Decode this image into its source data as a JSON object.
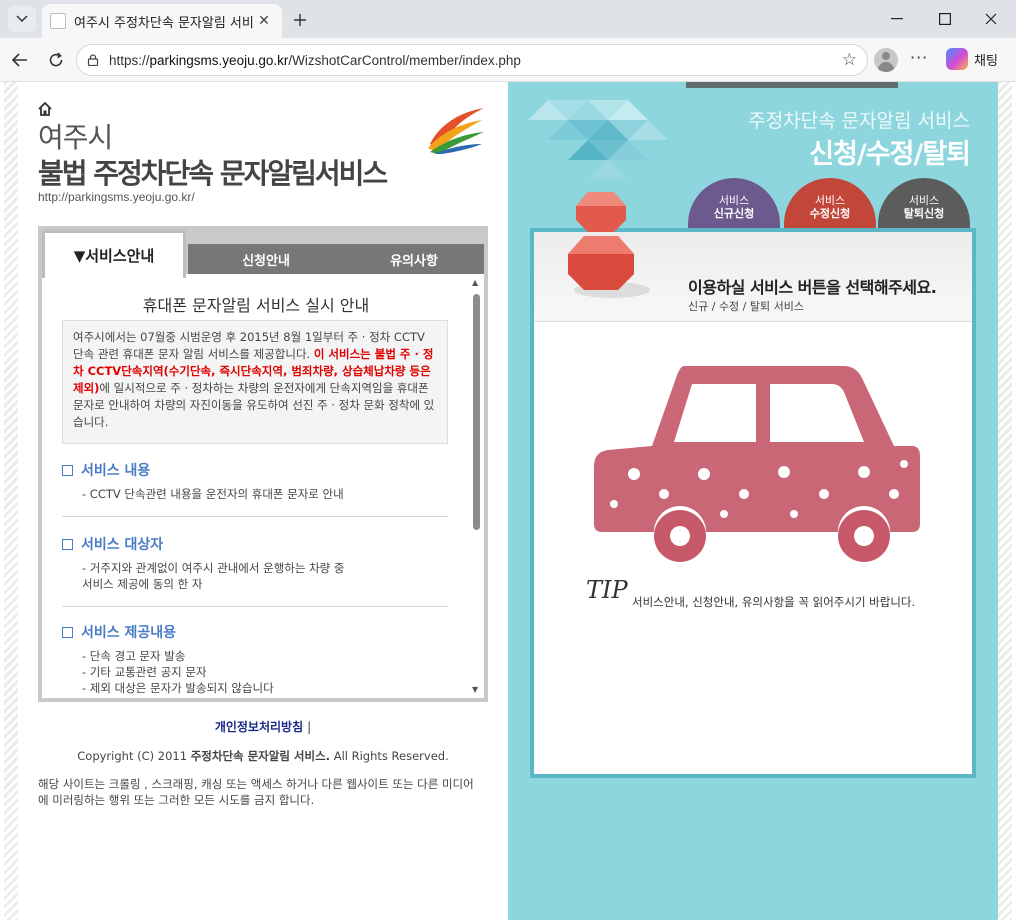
{
  "browser": {
    "tab_title": "여주시 주정차단속 문자알림 서비스",
    "url_prefix": "https://",
    "url_host": "parkingsms.yeoju.go.kr",
    "url_path": "/WizshotCarControl/member/index.php",
    "copilot_label": "채팅"
  },
  "header": {
    "city": "여주시",
    "service": "불법 주정차단속 문자알림서비스",
    "site_url": "http://parkingsms.yeoju.go.kr/"
  },
  "info_tabs": {
    "service_info": "▼서비스안내",
    "apply_info": "신청안내",
    "notice": "유의사항"
  },
  "content": {
    "title": "휴대폰 문자알림 서비스 실시 안내",
    "notice_line1": "여주시에서는 07월중 시범운영 후 2015년 8월 1일부터 주 · 정차 CCTV 단속 관련 휴대폰 문자 알림 서비스를 제공합니다.",
    "notice_red": "이 서비스는 불법 주 · 정차 CCTV단속지역(수기단속, 즉시단속지역, 범죄차량, 상습체납차량 등은 제외)",
    "notice_line2": "에 일시적으로 주 · 정차하는 차량의 운전자에게 단속지역임을 휴대폰 문자로 안내하여 차량의 자진이동을 유도하여 선진 주 · 정차 문화 정착에 있습니다.",
    "sections": [
      {
        "heading": "서비스 내용",
        "lines": [
          "- CCTV 단속관련 내용을 운전자의 휴대폰 문자로 안내"
        ]
      },
      {
        "heading": "서비스 대상자",
        "lines": [
          "- 거주지와 관계없이 여주시 관내에서 운행하는 차량 중",
          "서비스 제공에 동의 한 자"
        ]
      },
      {
        "heading": "서비스 제공내용",
        "lines": [
          "- 단속 경고 문자 발송",
          "- 기타 교통관련 공지 문자",
          "- 제외 대상은 문자가 발송되지 않습니다"
        ]
      }
    ]
  },
  "footer": {
    "privacy": "개인정보처리방침",
    "separator": "|",
    "copyright_prefix": "Copyright (C) 2011 ",
    "copyright_bold": "주정차단속 문자알림 서비스.",
    "copyright_suffix": " All Rights Reserved.",
    "legal": "해당 사이트는 크롤링 , 스크래핑, 캐싱 또는 액세스 하거나 다른 웹사이트 또는 다른 미디어에 미러링하는 행위 또는 그러한 모든 시도를 금지 합니다."
  },
  "apply": {
    "subtitle": "주정차단속 문자알림 서비스",
    "title": "신청/수정/탈퇴",
    "buttons": [
      {
        "top": "서비스",
        "bottom": "신규신청"
      },
      {
        "top": "서비스",
        "bottom": "수정신청"
      },
      {
        "top": "서비스",
        "bottom": "탈퇴신청"
      }
    ],
    "prompt": "이용하실 서비스 버튼을 선택해주세요.",
    "prompt_sub": "신규 / 수정 / 탈퇴 서비스",
    "tip_label": "TIP",
    "tip_text": "서비스안내, 신청안내, 유의사항을 꼭 읽어주시기 바랍니다."
  },
  "colors": {
    "accent_blue": "#4a7cc4",
    "red_text": "#e00000",
    "panel_teal": "#8dd6de",
    "btn_new": "#6c5a8e",
    "btn_edit": "#c2473a",
    "btn_leave": "#5c5c5c",
    "car_pink": "#c65a6a"
  },
  "icons": [
    "chevron-down-icon",
    "close-icon",
    "plus-icon",
    "minimize-icon",
    "maximize-icon",
    "back-icon",
    "reload-icon",
    "lock-icon",
    "star-icon",
    "home-icon",
    "square-bullet-icon"
  ]
}
